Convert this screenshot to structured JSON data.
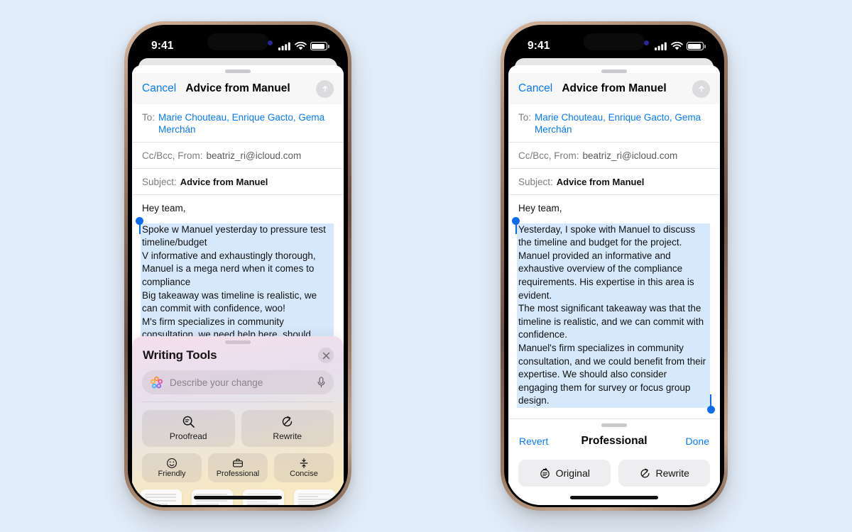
{
  "background_color": "#e3eefb",
  "accent_blue": "#067aff",
  "selection_blue": "#d6e8fb",
  "status_bar": {
    "time": "9:41",
    "cellular_icon": "cellular-bars-icon",
    "wifi_icon": "wifi-icon",
    "battery_icon": "battery-full-icon"
  },
  "left_phone": {
    "mail": {
      "cancel_label": "Cancel",
      "title": "Advice from Manuel",
      "send_icon": "send-arrow-up-icon",
      "to_label": "To:",
      "to_value": "Marie Chouteau, Enrique Gacto, Gema Merchán",
      "cc_label": "Cc/Bcc, From:",
      "cc_value": "beatriz_ri@icloud.com",
      "subject_label": "Subject:",
      "subject_value": "Advice from Manuel",
      "greeting": "Hey team,",
      "body_lines": [
        "Spoke w Manuel yesterday to pressure test timeline/budget",
        "V informative and exhaustingly thorough, Manuel is a mega nerd when it comes to compliance",
        "Big takeaway was timeline is realistic, we can commit with confidence, woo!",
        "M's firm specializes in community consultation, we need help here, should consider engaging them for survey/focus group design"
      ]
    },
    "writing_tools": {
      "title": "Writing Tools",
      "close_icon": "close-x-icon",
      "sparkle_icon": "apple-intelligence-icon",
      "search_placeholder": "Describe your change",
      "mic_icon": "microphone-icon",
      "primary_actions": [
        {
          "label": "Proofread",
          "icon": "magnifier-minus-icon"
        },
        {
          "label": "Rewrite",
          "icon": "rewrite-circle-arrow-icon"
        }
      ],
      "tone_actions": [
        {
          "label": "Friendly",
          "icon": "smiley-face-icon"
        },
        {
          "label": "Professional",
          "icon": "briefcase-icon"
        },
        {
          "label": "Concise",
          "icon": "compress-arrows-icon"
        }
      ],
      "thumbnails": [
        {
          "name": "summary-card",
          "style": "lines",
          "download": true
        },
        {
          "name": "key-points-card",
          "style": "lines",
          "download": true
        },
        {
          "name": "list-card",
          "style": "dense",
          "download": true
        },
        {
          "name": "table-card",
          "style": "dense",
          "download": true
        }
      ]
    }
  },
  "right_phone": {
    "mail": {
      "cancel_label": "Cancel",
      "title": "Advice from Manuel",
      "send_icon": "send-arrow-up-icon",
      "to_label": "To:",
      "to_value": "Marie Chouteau, Enrique Gacto, Gema Merchán",
      "cc_label": "Cc/Bcc, From:",
      "cc_value": "beatriz_ri@icloud.com",
      "subject_label": "Subject:",
      "subject_value": "Advice from Manuel",
      "greeting": "Hey team,",
      "body_lines": [
        "Yesterday, I spoke with Manuel to discuss the timeline and budget for the project.",
        "Manuel provided an informative and exhaustive overview of the compliance requirements. His expertise in this area is evident.",
        "The most significant takeaway was that the timeline is realistic, and we can commit with confidence.",
        "Manuel's firm specializes in community consultation, and we could benefit from their expertise. We should also consider engaging them for survey or focus group design."
      ]
    },
    "rewrite_bar": {
      "revert_label": "Revert",
      "title": "Professional",
      "done_label": "Done",
      "buttons": [
        {
          "label": "Original",
          "icon": "original-text-circle-icon"
        },
        {
          "label": "Rewrite",
          "icon": "rewrite-circle-arrow-icon"
        }
      ]
    }
  }
}
